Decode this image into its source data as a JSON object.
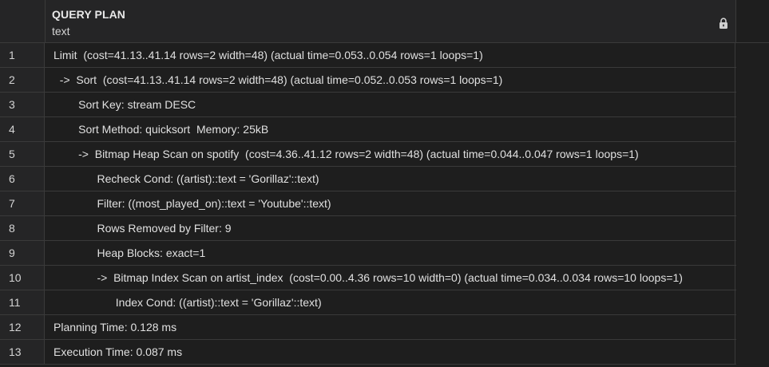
{
  "column": {
    "name": "QUERY PLAN",
    "type": "text",
    "lock_icon": "lock-icon"
  },
  "rows": [
    {
      "num": "1",
      "text": "Limit  (cost=41.13..41.14 rows=2 width=48) (actual time=0.053..0.054 rows=1 loops=1)"
    },
    {
      "num": "2",
      "text": "  ->  Sort  (cost=41.13..41.14 rows=2 width=48) (actual time=0.052..0.053 rows=1 loops=1)"
    },
    {
      "num": "3",
      "text": "        Sort Key: stream DESC"
    },
    {
      "num": "4",
      "text": "        Sort Method: quicksort  Memory: 25kB"
    },
    {
      "num": "5",
      "text": "        ->  Bitmap Heap Scan on spotify  (cost=4.36..41.12 rows=2 width=48) (actual time=0.044..0.047 rows=1 loops=1)"
    },
    {
      "num": "6",
      "text": "              Recheck Cond: ((artist)::text = 'Gorillaz'::text)"
    },
    {
      "num": "7",
      "text": "              Filter: ((most_played_on)::text = 'Youtube'::text)"
    },
    {
      "num": "8",
      "text": "              Rows Removed by Filter: 9"
    },
    {
      "num": "9",
      "text": "              Heap Blocks: exact=1"
    },
    {
      "num": "10",
      "text": "              ->  Bitmap Index Scan on artist_index  (cost=0.00..4.36 rows=10 width=0) (actual time=0.034..0.034 rows=10 loops=1)"
    },
    {
      "num": "11",
      "text": "                    Index Cond: ((artist)::text = 'Gorillaz'::text)"
    },
    {
      "num": "12",
      "text": "Planning Time: 0.128 ms"
    },
    {
      "num": "13",
      "text": "Execution Time: 0.087 ms"
    }
  ]
}
